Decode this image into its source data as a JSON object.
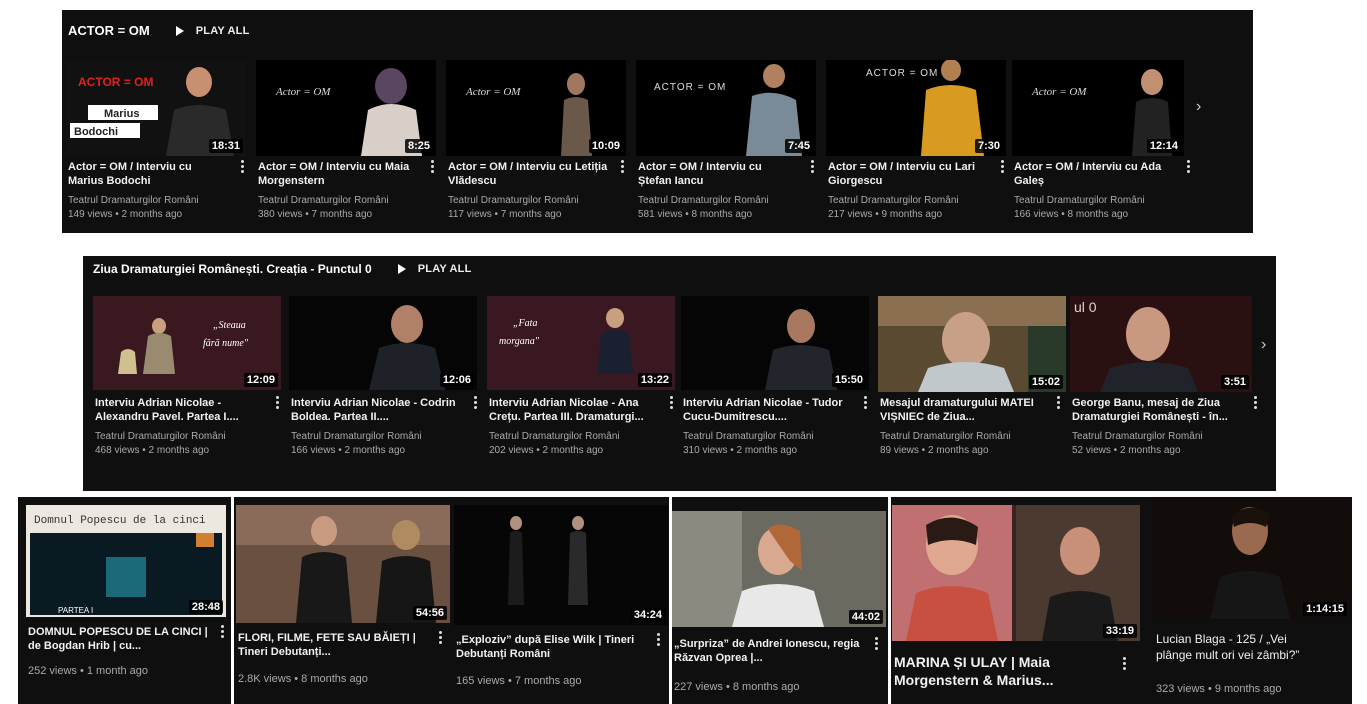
{
  "shelf1": {
    "title": "ACTOR = OM",
    "play_all": "PLAY ALL",
    "videos": [
      {
        "title": "Actor = OM / Interviu cu Marius Bodochi",
        "channel": "Teatrul Dramaturgilor Români",
        "meta": "149 views • 2 months ago",
        "duration": "18:31",
        "overlay_a": "ACTOR = OM",
        "overlay_b": "Marius",
        "overlay_c": "Bodochi"
      },
      {
        "title": "Actor = OM / Interviu cu Maia Morgenstern",
        "channel": "Teatrul Dramaturgilor Români",
        "meta": "380 views • 7 months ago",
        "duration": "8:25",
        "logo": "Actor = OM"
      },
      {
        "title": "Actor = OM / Interviu cu Letiția Vlădescu",
        "channel": "Teatrul Dramaturgilor Români",
        "meta": "117 views • 7 months ago",
        "duration": "10:09",
        "logo": "Actor = OM"
      },
      {
        "title": "Actor = OM / Interviu cu Ștefan Iancu",
        "channel": "Teatrul Dramaturgilor Români",
        "meta": "581 views • 8 months ago",
        "duration": "7:45",
        "logo": "ACTOR = OM"
      },
      {
        "title": "Actor = OM / Interviu cu Lari Giorgescu",
        "channel": "Teatrul Dramaturgilor Români",
        "meta": "217 views • 9 months ago",
        "duration": "7:30",
        "logo": "ACTOR = OM"
      },
      {
        "title": "Actor = OM / Interviu cu Ada Galeș",
        "channel": "Teatrul Dramaturgilor Români",
        "meta": "166 views • 8 months ago",
        "duration": "12:14",
        "logo": "Actor = OM"
      }
    ]
  },
  "shelf2": {
    "title": "Ziua Dramaturgiei Românești. Creația - Punctul 0",
    "play_all": "PLAY ALL",
    "videos": [
      {
        "title": "Interviu Adrian Nicolae - Alexandru Pavel. Partea I....",
        "channel": "Teatrul Dramaturgilor Români",
        "meta": "468 views • 2 months ago",
        "duration": "12:09",
        "overlay": "\"Steaua fără nume\""
      },
      {
        "title": "Interviu Adrian Nicolae - Codrin Boldea. Partea II....",
        "channel": "Teatrul Dramaturgilor Români",
        "meta": "166 views • 2 months ago",
        "duration": "12:06"
      },
      {
        "title": "Interviu Adrian Nicolae - Ana Crețu. Partea III. Dramaturgi...",
        "channel": "Teatrul Dramaturgilor Români",
        "meta": "202 views • 2 months ago",
        "duration": "13:22",
        "overlay": "\"Fata morgana\""
      },
      {
        "title": "Interviu Adrian Nicolae - Tudor Cucu-Dumitrescu....",
        "channel": "Teatrul Dramaturgilor Români",
        "meta": "310 views • 2 months ago",
        "duration": "15:50"
      },
      {
        "title": "Mesajul dramaturgului MATEI VIȘNIEC de Ziua...",
        "channel": "Teatrul Dramaturgilor Români",
        "meta": "89 views • 2 months ago",
        "duration": "15:02"
      },
      {
        "title": "George Banu, mesaj de Ziua Dramaturgiei Românești - în...",
        "channel": "Teatrul Dramaturgilor Români",
        "meta": "52 views • 2 months ago",
        "duration": "3:51",
        "overlay": "ul 0"
      }
    ]
  },
  "shelf3": {
    "videos": [
      {
        "title": "DOMNUL POPESCU DE LA CINCI | de Bogdan Hrib | cu...",
        "meta": "252 views • 1 month ago",
        "duration": "28:48",
        "overlay": "Domnul Popescu de la cinci",
        "overlay2": "PARTEA I"
      },
      {
        "title": "FLORI, FILME, FETE SAU BĂIEȚI | Tineri Debutanți...",
        "meta": "2.8K views • 8 months ago",
        "duration": "54:56"
      },
      {
        "title": "„Exploziv” după Elise Wilk | Tineri Debutanți Români",
        "meta": "165 views • 7 months ago",
        "duration": "34:24"
      },
      {
        "title": "„Surpriza” de Andrei Ionescu, regia Răzvan Oprea |...",
        "meta": "227 views • 8 months ago",
        "duration": "44:02"
      },
      {
        "title": "MARINA ȘI ULAY | Maia Morgenstern & Marius...",
        "meta": "",
        "duration": "33:19"
      },
      {
        "title": "Lucian Blaga - 125 / „Vei plânge mult ori vei zâmbi?”",
        "meta": "323 views • 9 months ago",
        "duration": "1:14:15"
      }
    ]
  },
  "colors": {
    "panel": "#0f0f0f",
    "text": "#f1f1f1",
    "meta": "#aaaaaa"
  }
}
